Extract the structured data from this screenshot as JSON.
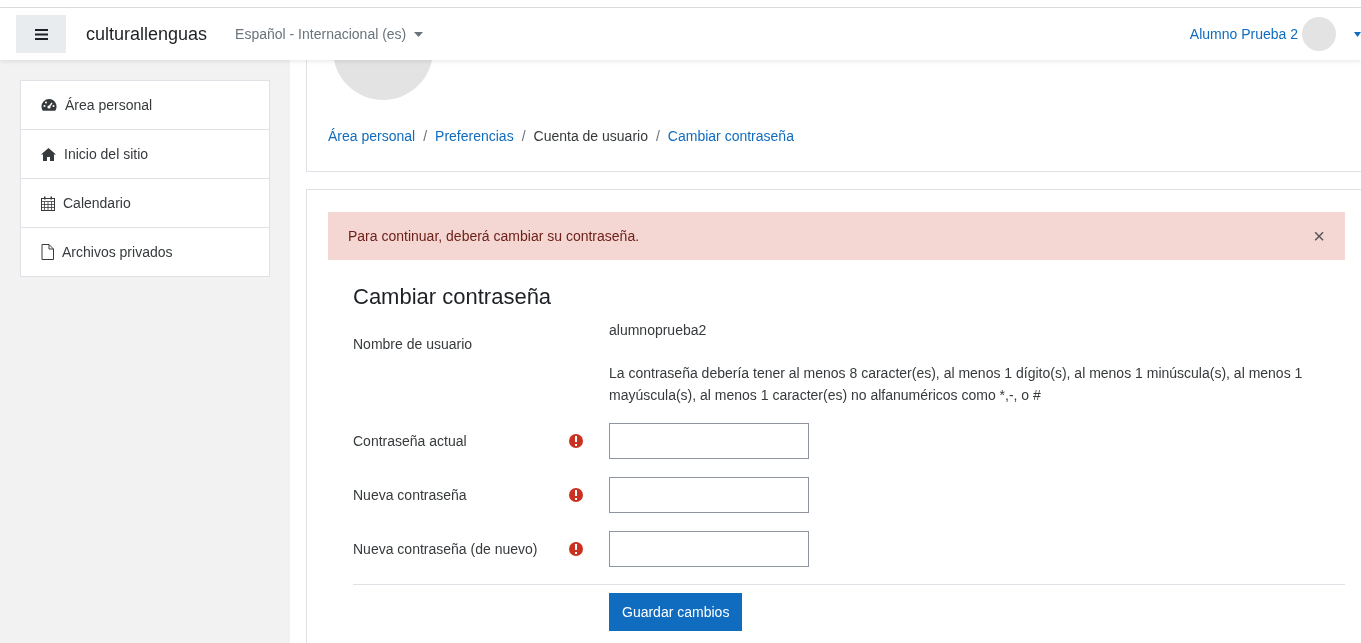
{
  "navbar": {
    "site_name": "culturallenguas",
    "language": "Español - Internacional (es)",
    "user_name": "Alumno Prueba 2"
  },
  "sidebar": {
    "items": [
      {
        "label": "Área personal"
      },
      {
        "label": "Inicio del sitio"
      },
      {
        "label": "Calendario"
      },
      {
        "label": "Archivos privados"
      }
    ]
  },
  "breadcrumb": [
    {
      "label": "Área personal",
      "link": true
    },
    {
      "separator": "/",
      "label": "Preferencias",
      "link": true
    },
    {
      "separator": "/",
      "label": "Cuenta de usuario",
      "link": false
    },
    {
      "separator": "/",
      "label": "Cambiar contraseña",
      "link": true
    }
  ],
  "alert": {
    "message": "Para continuar, deberá cambiar su contraseña.",
    "close": "×"
  },
  "form": {
    "title": "Cambiar contraseña",
    "username_label": "Nombre de usuario",
    "username": "alumnoprueba2",
    "policy": "La contraseña debería tener al menos 8 caracter(es), al menos 1 dígito(s), al menos 1 minúscula(s), al menos 1 mayúscula(s), al menos 1 caracter(es) no alfanuméricos como *,-, o #",
    "fields": [
      {
        "label": "Contraseña actual",
        "required": true
      },
      {
        "label": "Nueva contraseña",
        "required": true
      },
      {
        "label": "Nueva contraseña (de nuevo)",
        "required": true
      }
    ],
    "submit": "Guardar cambios"
  }
}
